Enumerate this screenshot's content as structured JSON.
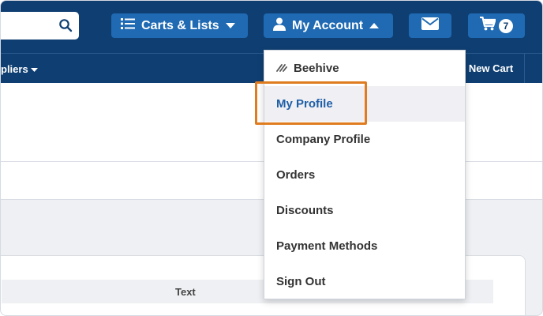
{
  "header": {
    "carts_label": "Carts & Lists",
    "account_label": "My Account",
    "cart_count": "7"
  },
  "nav": {
    "suppliers_label": "pliers",
    "new_cart_label": "New Cart"
  },
  "table": {
    "column_text": "Text"
  },
  "account_menu": {
    "items": [
      {
        "label": "Beehive"
      },
      {
        "label": "My Profile"
      },
      {
        "label": "Company Profile"
      },
      {
        "label": "Orders"
      },
      {
        "label": "Discounts"
      },
      {
        "label": "Payment Methods"
      },
      {
        "label": "Sign Out"
      }
    ],
    "active_item": "My Profile"
  },
  "colors": {
    "header_bg": "#0f3f72",
    "button_bg": "#1f6ab3",
    "active_text": "#1f5fa6",
    "highlight": "#e07c20"
  },
  "icons": [
    "search-icon",
    "list-icon",
    "caret-down-icon",
    "user-icon",
    "caret-up-icon",
    "mail-icon",
    "cart-icon",
    "beehive-icon"
  ]
}
